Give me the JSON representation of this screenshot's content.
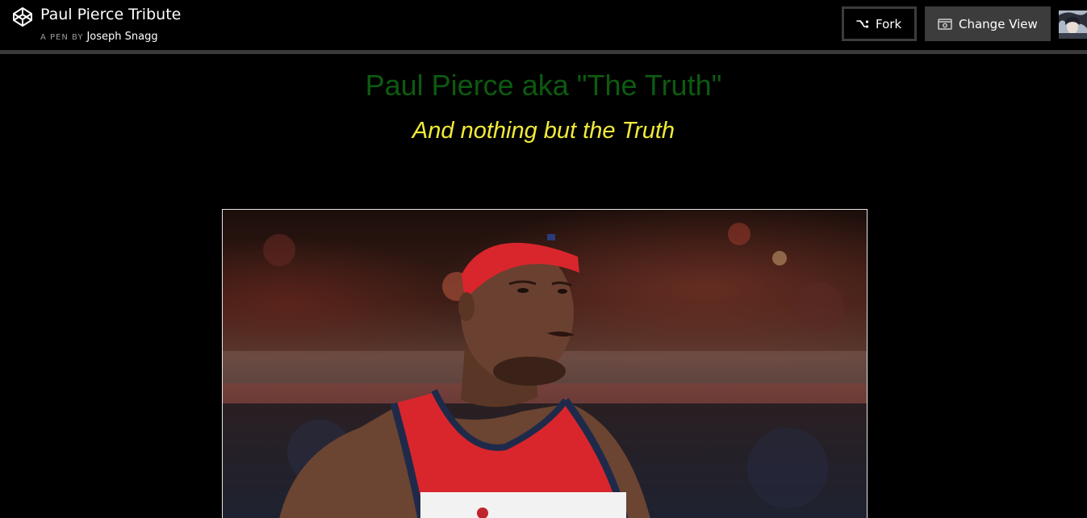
{
  "header": {
    "logo_icon": "codepen-logo-icon",
    "title": "Paul Pierce Tribute",
    "byline_prefix": "A PEN BY",
    "author": "Joseph Snagg",
    "fork_label": "Fork",
    "fork_icon": "fork-icon",
    "change_view_label": "Change View",
    "change_view_icon": "change-view-icon",
    "avatar_icon": "user-avatar"
  },
  "content": {
    "headline": "Paul Pierce aka \"The Truth\"",
    "subheadline": "And nothing but the Truth",
    "photo": "photo of Paul Pierce in a red headband and red, white and navy Washington jersey on a basketball court"
  },
  "colors": {
    "background": "#000000",
    "headline": "#0d5a10",
    "subheadline": "#f0ea3a",
    "button_dark": "#3c3c3c",
    "header_rule": "#3a3a3a"
  }
}
